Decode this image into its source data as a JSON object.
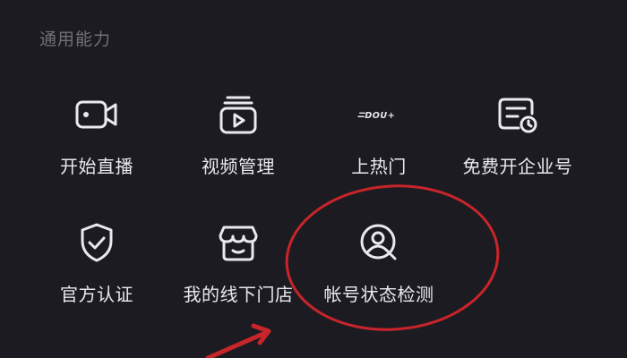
{
  "section": {
    "title": "通用能力"
  },
  "items": [
    {
      "label": "开始直播",
      "icon": "live-camera-icon"
    },
    {
      "label": "视频管理",
      "icon": "video-management-icon"
    },
    {
      "label": "上热门",
      "icon": "dou-plus-icon",
      "icon_text": "DOU+"
    },
    {
      "label": "免费开企业号",
      "icon": "enterprise-account-icon"
    },
    {
      "label": "官方认证",
      "icon": "shield-check-icon"
    },
    {
      "label": "我的线下门店",
      "icon": "store-icon"
    },
    {
      "label": "帐号状态检测",
      "icon": "account-status-icon"
    }
  ],
  "annotation_colors": {
    "circle": "#c8252a",
    "arrow": "#c8252a"
  },
  "colors": {
    "background": "#1c1b21",
    "section_title": "#707078",
    "label": "#e9e9ee",
    "icon_stroke": "#e9e9ee"
  }
}
